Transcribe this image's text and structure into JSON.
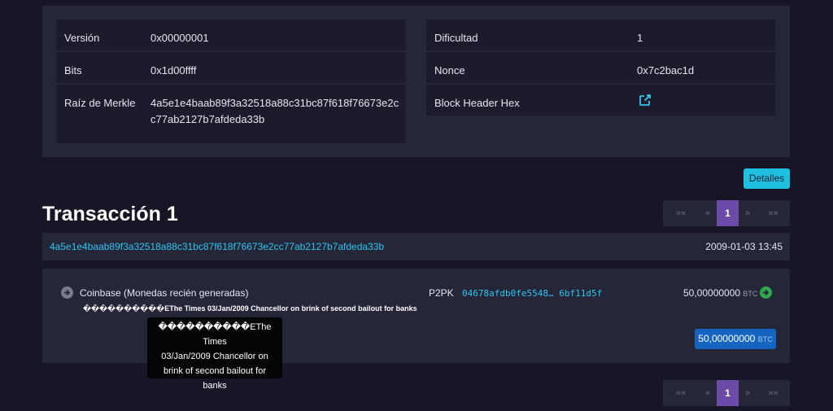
{
  "block_header": {
    "left": [
      {
        "label": "Versión",
        "value": "0x00000001"
      },
      {
        "label": "Bits",
        "value": "0x1d00ffff"
      },
      {
        "label": "Raíz de Merkle",
        "value_line1": "4a5e1e4baab89f3a32518a88c31bc87f618f76673e2c",
        "value_line2": "c77ab2127b7afdeda33b"
      }
    ],
    "right": [
      {
        "label": "Dificultad",
        "value": "1"
      },
      {
        "label": "Nonce",
        "value": "0x7c2bac1d"
      },
      {
        "label": "Block Header Hex",
        "icon": "external-link-icon"
      }
    ]
  },
  "details_button": "Detalles",
  "pagination": {
    "first": "««",
    "prev": "«",
    "current": "1",
    "next": "»",
    "last": "»»"
  },
  "transaction": {
    "title": "Transacción 1",
    "hash": "4a5e1e4baab89f3a32518a88c31bc87f618f76673e2cc77ab2127b7afdeda33b",
    "date": "2009-01-03 13:45",
    "input": {
      "label": "Coinbase (Monedas recién generadas)",
      "message": "����������EThe Times 03/Jan/2009 Chancellor on brink of second bailout for banks"
    },
    "output": {
      "type": "P2PK",
      "address": "04678afdb0fe5548… 6bf11d5f",
      "amount": "50,00000000",
      "unit": "BTC"
    },
    "total": {
      "amount": "50,00000000",
      "unit": "BTC"
    }
  },
  "tooltip": {
    "line1": "����������EThe Times",
    "line2": "03/Jan/2009 Chancellor on",
    "line3": "brink of second bailout for",
    "line4": "banks"
  },
  "colors": {
    "accent": "#1fbfe0",
    "link": "#2fc6ef",
    "page_active": "#6b4aa8",
    "total_btn": "#1565c0",
    "ok_green": "#2eaa4a"
  }
}
